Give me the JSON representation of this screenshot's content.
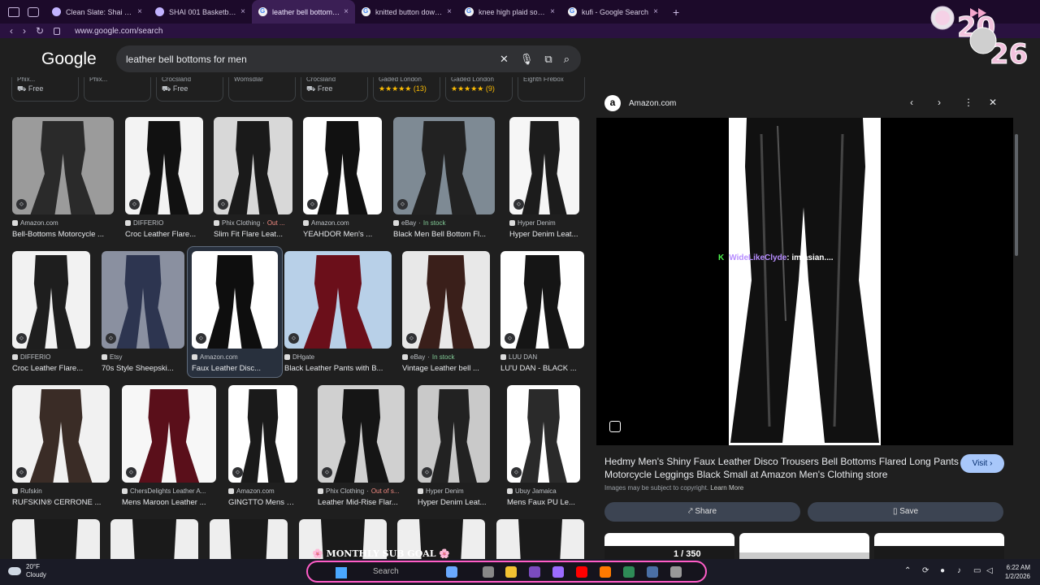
{
  "tabs": [
    {
      "label": "Clean Slate: Shai Gilgeous",
      "fav": "m"
    },
    {
      "label": "SHAI 001 Basketball Low",
      "fav": "m"
    },
    {
      "label": "leather bell bottoms for me",
      "fav": "g",
      "active": true
    },
    {
      "label": "knitted button down for m",
      "fav": "g"
    },
    {
      "label": "knee high plaid socks - G",
      "fav": "g"
    },
    {
      "label": "kufi - Google Search",
      "fav": "g"
    }
  ],
  "address": {
    "url": "www.google.com/search"
  },
  "google": {
    "logo": "Google",
    "query": "leather bell bottoms for men"
  },
  "chips": [
    {
      "top": "Phix...",
      "text": "Free",
      "icon": "truck"
    },
    {
      "top": "Phix...",
      "text": "",
      "icon": ""
    },
    {
      "top": "Crocsland",
      "text": "Free",
      "icon": "truck"
    },
    {
      "top": "Womsdlar",
      "text": "",
      "icon": ""
    },
    {
      "top": "Crocsland",
      "text": "Free",
      "icon": "truck"
    },
    {
      "top": "Gaded London",
      "text": "★★★★★ (13)",
      "icon": ""
    },
    {
      "top": "Gaded London",
      "text": "★★★★★ (9)",
      "icon": ""
    },
    {
      "top": "Eighth Frebox",
      "text": "",
      "icon": ""
    }
  ],
  "results": [
    [
      {
        "source": "Amazon.com",
        "title": "Bell-Bottoms Motorcycle ..."
      },
      {
        "source": "DIFFERIO",
        "title": "Croc Leather Flare..."
      },
      {
        "source": "Phix Clothing",
        "status": "Out ...",
        "status_type": "out",
        "title": "Slim Fit Flare Leat..."
      },
      {
        "source": "Amazon.com",
        "title": "YEAHDOR Men's ..."
      },
      {
        "source": "eBay",
        "status": "In stock",
        "status_type": "stock",
        "title": "Black Men Bell Bottom Fl..."
      },
      {
        "source": "Hyper Denim",
        "title": "Hyper Denim Leat..."
      }
    ],
    [
      {
        "source": "DIFFERIO",
        "title": "Croc Leather Flare..."
      },
      {
        "source": "Etsy",
        "title": "70s Style Sheepski..."
      },
      {
        "source": "Amazon.com",
        "title": "Faux Leather Disc...",
        "selected": true
      },
      {
        "source": "DHgate",
        "title": "Black Leather Pants with B..."
      },
      {
        "source": "eBay",
        "status": "In stock",
        "status_type": "stock",
        "title": "Vintage Leather bell ..."
      },
      {
        "source": "LUU DAN",
        "title": "LU'U DAN - BLACK ..."
      }
    ],
    [
      {
        "source": "Rufskin",
        "title": "RUFSKIN® CERRONE ..."
      },
      {
        "source": "ChersDelights Leather A...",
        "title": "Mens Maroon Leather ..."
      },
      {
        "source": "Amazon.com",
        "title": "GINGTTO Mens W..."
      },
      {
        "source": "Phix Clothing",
        "status": "Out of s...",
        "status_type": "out",
        "title": "Leather Mid-Rise Flar..."
      },
      {
        "source": "Hyper Denim",
        "title": "Hyper Denim Leat..."
      },
      {
        "source": "Ubuy Jamaica",
        "title": "Mens Faux PU Le..."
      }
    ]
  ],
  "panel": {
    "source": "Amazon.com",
    "title": "Hedmy Men's Shiny Faux Leather Disco Trousers Bell Bottoms Flared Long Pants Motorcycle Leggings Black Small at Amazon Men's Clothing store",
    "visit": "Visit",
    "copyright": "Images may be subject to copyright.",
    "learn_more": "Learn More",
    "share": "Share",
    "save": "Save",
    "overlay_user": "WideLikeClyde",
    "overlay_msg": ": im asian....",
    "counter": "1 / 350"
  },
  "stream": {
    "sub_goal": "🌸 MONTHLY SUB GOAL 🌸"
  },
  "taskbar": {
    "temp": "20°F",
    "condition": "Cloudy",
    "search": "Search",
    "time": "6:22 AM",
    "date": "1/2/2026"
  },
  "colors": {
    "accent": "#a8c7fa",
    "stock": "#81c995",
    "out": "#f28b82",
    "tabbar": "#1c0a2a",
    "stream_border": "#ff5dc8"
  }
}
